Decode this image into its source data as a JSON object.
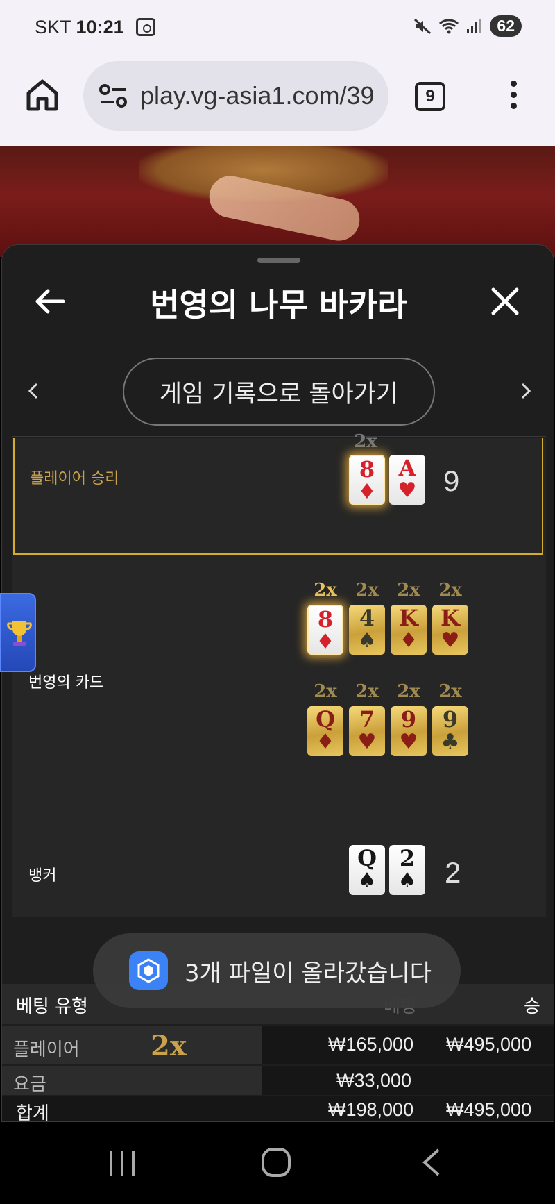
{
  "status_bar": {
    "carrier": "SKT",
    "time": "10:21",
    "battery": "62"
  },
  "browser": {
    "url": "play.vg-asia1.com/39",
    "tab_count": "9"
  },
  "sheet": {
    "title": "번영의 나무 바카라",
    "back_to_history": "게임 기록으로 돌아가기",
    "player_win_label": "플레이어 승리",
    "player_cards": [
      {
        "rank": "8",
        "suit": "♦",
        "multiplier": "2x"
      },
      {
        "rank": "A",
        "suit": "♥"
      }
    ],
    "player_score": "9",
    "prosperity_label": "번영의 카드",
    "prosperity_cards_row1": [
      {
        "rank": "8",
        "suit": "♦",
        "multiplier": "2x"
      },
      {
        "rank": "4",
        "suit": "♠",
        "multiplier": "2x"
      },
      {
        "rank": "K",
        "suit": "♦",
        "multiplier": "2x"
      },
      {
        "rank": "K",
        "suit": "♥",
        "multiplier": "2x"
      }
    ],
    "prosperity_cards_row2": [
      {
        "rank": "Q",
        "suit": "♦",
        "multiplier": "2x"
      },
      {
        "rank": "7",
        "suit": "♥",
        "multiplier": "2x"
      },
      {
        "rank": "9",
        "suit": "♥",
        "multiplier": "2x"
      },
      {
        "rank": "9",
        "suit": "♣",
        "multiplier": "2x"
      }
    ],
    "banker_label": "뱅커",
    "banker_cards": [
      {
        "rank": "Q",
        "suit": "♠"
      },
      {
        "rank": "2",
        "suit": "♠"
      }
    ],
    "banker_score": "2"
  },
  "bet_table": {
    "headers": {
      "type": "베팅 유형",
      "bet": "베팅",
      "win": "승"
    },
    "rows": [
      {
        "type": "플레이어",
        "multiplier": "2x",
        "bet": "₩165,000",
        "win": "₩495,000"
      },
      {
        "type": "요금",
        "bet": "₩33,000",
        "win": ""
      },
      {
        "type": "합계",
        "bet": "₩198,000",
        "win": "₩495,000"
      }
    ]
  },
  "toast": {
    "message": "3개 파일이 올라갔습니다"
  }
}
